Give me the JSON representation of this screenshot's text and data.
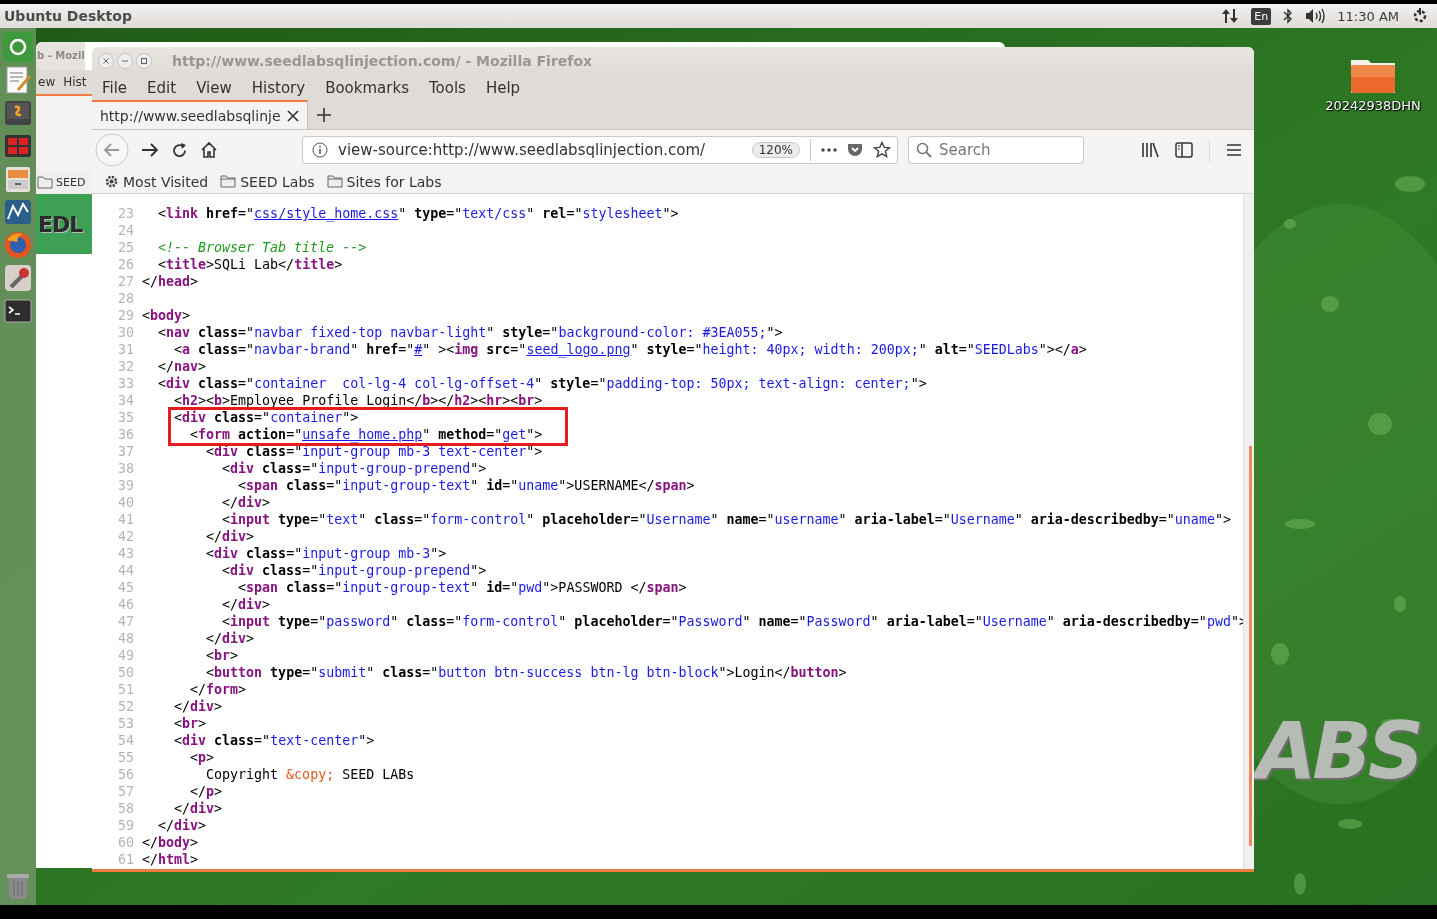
{
  "top_panel": {
    "title": "Ubuntu Desktop",
    "keyboard": "En",
    "time": "11:30 AM"
  },
  "desktop": {
    "folder_label": "20242938DHN",
    "logo_text": "ABS"
  },
  "background_window": {
    "title": "b - Mozil",
    "menu": [
      "ew",
      "Hist"
    ],
    "bookmark": "SEED",
    "banner_text": "EDL"
  },
  "browser": {
    "title": "http://www.seedlabsqlinjection.com/ - Mozilla Firefox",
    "menu": [
      "File",
      "Edit",
      "View",
      "History",
      "Bookmarks",
      "Tools",
      "Help"
    ],
    "tabs": [
      {
        "label": "http://www.seedlabsqlinje",
        "selected": true
      }
    ],
    "url": "view-source:http://www.seedlabsqlinjection.com/",
    "zoom": "120%",
    "search": {
      "placeholder": "Search"
    },
    "bookmarks": [
      {
        "kind": "smart",
        "label": "Most Visited"
      },
      {
        "kind": "folder",
        "label": "SEED Labs"
      },
      {
        "kind": "folder",
        "label": "Sites for Labs"
      }
    ],
    "source": {
      "lines": [
        {
          "n": "23",
          "tokens": [
            {
              "kind": "p",
              "text": "  <"
            },
            {
              "kind": "tag",
              "text": "link"
            },
            {
              "kind": "attr",
              "text": " href"
            },
            {
              "kind": "p",
              "text": "=\""
            },
            {
              "kind": "link",
              "text": "css/style_home.css"
            },
            {
              "kind": "p",
              "text": "\""
            },
            {
              "kind": "attr",
              "text": " type"
            },
            {
              "kind": "p",
              "text": "=\""
            },
            {
              "kind": "val",
              "text": "text/css"
            },
            {
              "kind": "p",
              "text": "\""
            },
            {
              "kind": "attr",
              "text": " rel"
            },
            {
              "kind": "p",
              "text": "=\""
            },
            {
              "kind": "val",
              "text": "stylesheet"
            },
            {
              "kind": "p",
              "text": "\">"
            }
          ]
        },
        {
          "n": "24"
        },
        {
          "n": "25",
          "tokens": [
            {
              "kind": "cmt",
              "text": "  <!-- Browser Tab title -->"
            }
          ]
        },
        {
          "n": "26",
          "tokens": [
            {
              "kind": "p",
              "text": "  <"
            },
            {
              "kind": "tag",
              "text": "title"
            },
            {
              "kind": "p",
              "text": ">SQLi Lab</"
            },
            {
              "kind": "tag",
              "text": "title"
            },
            {
              "kind": "p",
              "text": ">"
            }
          ]
        },
        {
          "n": "27",
          "tokens": [
            {
              "kind": "p",
              "text": "</"
            },
            {
              "kind": "tag",
              "text": "head"
            },
            {
              "kind": "p",
              "text": ">"
            }
          ]
        },
        {
          "n": "28"
        },
        {
          "n": "29",
          "tokens": [
            {
              "kind": "p",
              "text": "<"
            },
            {
              "kind": "tag",
              "text": "body"
            },
            {
              "kind": "p",
              "text": ">"
            }
          ]
        },
        {
          "n": "30",
          "tokens": [
            {
              "kind": "p",
              "text": "  <"
            },
            {
              "kind": "tag",
              "text": "nav"
            },
            {
              "kind": "attr",
              "text": " class"
            },
            {
              "kind": "p",
              "text": "=\""
            },
            {
              "kind": "val",
              "text": "navbar fixed-top navbar-light"
            },
            {
              "kind": "p",
              "text": "\""
            },
            {
              "kind": "attr",
              "text": " style"
            },
            {
              "kind": "p",
              "text": "=\""
            },
            {
              "kind": "val",
              "text": "background-color: #3EA055;"
            },
            {
              "kind": "p",
              "text": "\">"
            }
          ]
        },
        {
          "n": "31",
          "tokens": [
            {
              "kind": "p",
              "text": "    <"
            },
            {
              "kind": "tag",
              "text": "a"
            },
            {
              "kind": "attr",
              "text": " class"
            },
            {
              "kind": "p",
              "text": "=\""
            },
            {
              "kind": "val",
              "text": "navbar-brand"
            },
            {
              "kind": "p",
              "text": "\""
            },
            {
              "kind": "attr",
              "text": " href"
            },
            {
              "kind": "p",
              "text": "=\""
            },
            {
              "kind": "link",
              "text": "#"
            },
            {
              "kind": "p",
              "text": "\" ><"
            },
            {
              "kind": "tag",
              "text": "img"
            },
            {
              "kind": "attr",
              "text": " src"
            },
            {
              "kind": "p",
              "text": "=\""
            },
            {
              "kind": "link",
              "text": "seed_logo.png"
            },
            {
              "kind": "p",
              "text": "\""
            },
            {
              "kind": "attr",
              "text": " style"
            },
            {
              "kind": "p",
              "text": "=\""
            },
            {
              "kind": "val",
              "text": "height: 40px; width: 200px;"
            },
            {
              "kind": "p",
              "text": "\""
            },
            {
              "kind": "attr",
              "text": " alt"
            },
            {
              "kind": "p",
              "text": "=\""
            },
            {
              "kind": "val",
              "text": "SEEDLabs"
            },
            {
              "kind": "p",
              "text": "\"></"
            },
            {
              "kind": "tag",
              "text": "a"
            },
            {
              "kind": "p",
              "text": ">"
            }
          ]
        },
        {
          "n": "32",
          "tokens": [
            {
              "kind": "p",
              "text": "  </"
            },
            {
              "kind": "tag",
              "text": "nav"
            },
            {
              "kind": "p",
              "text": ">"
            }
          ]
        },
        {
          "n": "33",
          "tokens": [
            {
              "kind": "p",
              "text": "  <"
            },
            {
              "kind": "tag",
              "text": "div"
            },
            {
              "kind": "attr",
              "text": " class"
            },
            {
              "kind": "p",
              "text": "=\""
            },
            {
              "kind": "val",
              "text": "container  col-lg-4 col-lg-offset-4"
            },
            {
              "kind": "p",
              "text": "\""
            },
            {
              "kind": "attr",
              "text": " style"
            },
            {
              "kind": "p",
              "text": "=\""
            },
            {
              "kind": "val",
              "text": "padding-top: 50px; text-align: center;"
            },
            {
              "kind": "p",
              "text": "\">"
            }
          ]
        },
        {
          "n": "34",
          "tokens": [
            {
              "kind": "p",
              "text": "    <"
            },
            {
              "kind": "tag",
              "text": "h2"
            },
            {
              "kind": "p",
              "text": "><"
            },
            {
              "kind": "tag",
              "text": "b"
            },
            {
              "kind": "p",
              "text": ">Employee Profile Login</"
            },
            {
              "kind": "tag",
              "text": "b"
            },
            {
              "kind": "p",
              "text": "></"
            },
            {
              "kind": "tag",
              "text": "h2"
            },
            {
              "kind": "p",
              "text": "><"
            },
            {
              "kind": "tag",
              "text": "hr"
            },
            {
              "kind": "p",
              "text": "><"
            },
            {
              "kind": "tag",
              "text": "br"
            },
            {
              "kind": "p",
              "text": ">"
            }
          ]
        },
        {
          "n": "35",
          "tokens": [
            {
              "kind": "p",
              "text": "    <"
            },
            {
              "kind": "tag",
              "text": "div"
            },
            {
              "kind": "attr",
              "text": " class"
            },
            {
              "kind": "p",
              "text": "=\""
            },
            {
              "kind": "val",
              "text": "container"
            },
            {
              "kind": "p",
              "text": "\">"
            }
          ]
        },
        {
          "n": "36",
          "tokens": [
            {
              "kind": "p",
              "text": "      <"
            },
            {
              "kind": "tag",
              "text": "form"
            },
            {
              "kind": "attr",
              "text": " action"
            },
            {
              "kind": "p",
              "text": "=\""
            },
            {
              "kind": "link",
              "text": "unsafe_home.php"
            },
            {
              "kind": "p",
              "text": "\""
            },
            {
              "kind": "attr",
              "text": " method"
            },
            {
              "kind": "p",
              "text": "=\""
            },
            {
              "kind": "val",
              "text": "get"
            },
            {
              "kind": "p",
              "text": "\">"
            }
          ]
        },
        {
          "n": "37",
          "tokens": [
            {
              "kind": "p",
              "text": "        <"
            },
            {
              "kind": "tag",
              "text": "div"
            },
            {
              "kind": "attr",
              "text": " class"
            },
            {
              "kind": "p",
              "text": "=\""
            },
            {
              "kind": "val",
              "text": "input-group mb-3 text-center"
            },
            {
              "kind": "p",
              "text": "\">"
            }
          ]
        },
        {
          "n": "38",
          "tokens": [
            {
              "kind": "p",
              "text": "          <"
            },
            {
              "kind": "tag",
              "text": "div"
            },
            {
              "kind": "attr",
              "text": " class"
            },
            {
              "kind": "p",
              "text": "=\""
            },
            {
              "kind": "val",
              "text": "input-group-prepend"
            },
            {
              "kind": "p",
              "text": "\">"
            }
          ]
        },
        {
          "n": "39",
          "tokens": [
            {
              "kind": "p",
              "text": "            <"
            },
            {
              "kind": "tag",
              "text": "span"
            },
            {
              "kind": "attr",
              "text": " class"
            },
            {
              "kind": "p",
              "text": "=\""
            },
            {
              "kind": "val",
              "text": "input-group-text"
            },
            {
              "kind": "p",
              "text": "\""
            },
            {
              "kind": "attr",
              "text": " id"
            },
            {
              "kind": "p",
              "text": "=\""
            },
            {
              "kind": "val",
              "text": "uname"
            },
            {
              "kind": "p",
              "text": "\">USERNAME</"
            },
            {
              "kind": "tag",
              "text": "span"
            },
            {
              "kind": "p",
              "text": ">"
            }
          ]
        },
        {
          "n": "40",
          "tokens": [
            {
              "kind": "p",
              "text": "          </"
            },
            {
              "kind": "tag",
              "text": "div"
            },
            {
              "kind": "p",
              "text": ">"
            }
          ]
        },
        {
          "n": "41",
          "tokens": [
            {
              "kind": "p",
              "text": "          <"
            },
            {
              "kind": "tag",
              "text": "input"
            },
            {
              "kind": "attr",
              "text": " type"
            },
            {
              "kind": "p",
              "text": "=\""
            },
            {
              "kind": "val",
              "text": "text"
            },
            {
              "kind": "p",
              "text": "\""
            },
            {
              "kind": "attr",
              "text": " class"
            },
            {
              "kind": "p",
              "text": "=\""
            },
            {
              "kind": "val",
              "text": "form-control"
            },
            {
              "kind": "p",
              "text": "\""
            },
            {
              "kind": "attr",
              "text": " placeholder"
            },
            {
              "kind": "p",
              "text": "=\""
            },
            {
              "kind": "val",
              "text": "Username"
            },
            {
              "kind": "p",
              "text": "\""
            },
            {
              "kind": "attr",
              "text": " name"
            },
            {
              "kind": "p",
              "text": "=\""
            },
            {
              "kind": "val",
              "text": "username"
            },
            {
              "kind": "p",
              "text": "\""
            },
            {
              "kind": "attr",
              "text": " aria-label"
            },
            {
              "kind": "p",
              "text": "=\""
            },
            {
              "kind": "val",
              "text": "Username"
            },
            {
              "kind": "p",
              "text": "\""
            },
            {
              "kind": "attr",
              "text": " aria-describedby"
            },
            {
              "kind": "p",
              "text": "=\""
            },
            {
              "kind": "val",
              "text": "uname"
            },
            {
              "kind": "p",
              "text": "\">"
            }
          ]
        },
        {
          "n": "42",
          "tokens": [
            {
              "kind": "p",
              "text": "        </"
            },
            {
              "kind": "tag",
              "text": "div"
            },
            {
              "kind": "p",
              "text": ">"
            }
          ]
        },
        {
          "n": "43",
          "tokens": [
            {
              "kind": "p",
              "text": "        <"
            },
            {
              "kind": "tag",
              "text": "div"
            },
            {
              "kind": "attr",
              "text": " class"
            },
            {
              "kind": "p",
              "text": "=\""
            },
            {
              "kind": "val",
              "text": "input-group mb-3"
            },
            {
              "kind": "p",
              "text": "\">"
            }
          ]
        },
        {
          "n": "44",
          "tokens": [
            {
              "kind": "p",
              "text": "          <"
            },
            {
              "kind": "tag",
              "text": "div"
            },
            {
              "kind": "attr",
              "text": " class"
            },
            {
              "kind": "p",
              "text": "=\""
            },
            {
              "kind": "val",
              "text": "input-group-prepend"
            },
            {
              "kind": "p",
              "text": "\">"
            }
          ]
        },
        {
          "n": "45",
          "tokens": [
            {
              "kind": "p",
              "text": "            <"
            },
            {
              "kind": "tag",
              "text": "span"
            },
            {
              "kind": "attr",
              "text": " class"
            },
            {
              "kind": "p",
              "text": "=\""
            },
            {
              "kind": "val",
              "text": "input-group-text"
            },
            {
              "kind": "p",
              "text": "\""
            },
            {
              "kind": "attr",
              "text": " id"
            },
            {
              "kind": "p",
              "text": "=\""
            },
            {
              "kind": "val",
              "text": "pwd"
            },
            {
              "kind": "p",
              "text": "\">PASSWORD </"
            },
            {
              "kind": "tag",
              "text": "span"
            },
            {
              "kind": "p",
              "text": ">"
            }
          ]
        },
        {
          "n": "46",
          "tokens": [
            {
              "kind": "p",
              "text": "          </"
            },
            {
              "kind": "tag",
              "text": "div"
            },
            {
              "kind": "p",
              "text": ">"
            }
          ]
        },
        {
          "n": "47",
          "tokens": [
            {
              "kind": "p",
              "text": "          <"
            },
            {
              "kind": "tag",
              "text": "input"
            },
            {
              "kind": "attr",
              "text": " type"
            },
            {
              "kind": "p",
              "text": "=\""
            },
            {
              "kind": "val",
              "text": "password"
            },
            {
              "kind": "p",
              "text": "\""
            },
            {
              "kind": "attr",
              "text": " class"
            },
            {
              "kind": "p",
              "text": "=\""
            },
            {
              "kind": "val",
              "text": "form-control"
            },
            {
              "kind": "p",
              "text": "\""
            },
            {
              "kind": "attr",
              "text": " placeholder"
            },
            {
              "kind": "p",
              "text": "=\""
            },
            {
              "kind": "val",
              "text": "Password"
            },
            {
              "kind": "p",
              "text": "\""
            },
            {
              "kind": "attr",
              "text": " name"
            },
            {
              "kind": "p",
              "text": "=\""
            },
            {
              "kind": "val",
              "text": "Password"
            },
            {
              "kind": "p",
              "text": "\""
            },
            {
              "kind": "attr",
              "text": " aria-label"
            },
            {
              "kind": "p",
              "text": "=\""
            },
            {
              "kind": "val",
              "text": "Username"
            },
            {
              "kind": "p",
              "text": "\""
            },
            {
              "kind": "attr",
              "text": " aria-describedby"
            },
            {
              "kind": "p",
              "text": "=\""
            },
            {
              "kind": "val",
              "text": "pwd"
            },
            {
              "kind": "p",
              "text": "\">"
            }
          ]
        },
        {
          "n": "48",
          "tokens": [
            {
              "kind": "p",
              "text": "        </"
            },
            {
              "kind": "tag",
              "text": "div"
            },
            {
              "kind": "p",
              "text": ">"
            }
          ]
        },
        {
          "n": "49",
          "tokens": [
            {
              "kind": "p",
              "text": "        <"
            },
            {
              "kind": "tag",
              "text": "br"
            },
            {
              "kind": "p",
              "text": ">"
            }
          ]
        },
        {
          "n": "50",
          "tokens": [
            {
              "kind": "p",
              "text": "        <"
            },
            {
              "kind": "tag",
              "text": "button"
            },
            {
              "kind": "attr",
              "text": " type"
            },
            {
              "kind": "p",
              "text": "=\""
            },
            {
              "kind": "val",
              "text": "submit"
            },
            {
              "kind": "p",
              "text": "\""
            },
            {
              "kind": "attr",
              "text": " class"
            },
            {
              "kind": "p",
              "text": "=\""
            },
            {
              "kind": "val",
              "text": "button btn-success btn-lg btn-block"
            },
            {
              "kind": "p",
              "text": "\">Login</"
            },
            {
              "kind": "tag",
              "text": "button"
            },
            {
              "kind": "p",
              "text": ">"
            }
          ]
        },
        {
          "n": "51",
          "tokens": [
            {
              "kind": "p",
              "text": "      </"
            },
            {
              "kind": "tag",
              "text": "form"
            },
            {
              "kind": "p",
              "text": ">"
            }
          ]
        },
        {
          "n": "52",
          "tokens": [
            {
              "kind": "p",
              "text": "    </"
            },
            {
              "kind": "tag",
              "text": "div"
            },
            {
              "kind": "p",
              "text": ">"
            }
          ]
        },
        {
          "n": "53",
          "tokens": [
            {
              "kind": "p",
              "text": "    <"
            },
            {
              "kind": "tag",
              "text": "br"
            },
            {
              "kind": "p",
              "text": ">"
            }
          ]
        },
        {
          "n": "54",
          "tokens": [
            {
              "kind": "p",
              "text": "    <"
            },
            {
              "kind": "tag",
              "text": "div"
            },
            {
              "kind": "attr",
              "text": " class"
            },
            {
              "kind": "p",
              "text": "=\""
            },
            {
              "kind": "val",
              "text": "text-center"
            },
            {
              "kind": "p",
              "text": "\">"
            }
          ]
        },
        {
          "n": "55",
          "tokens": [
            {
              "kind": "p",
              "text": "      <"
            },
            {
              "kind": "tag",
              "text": "p"
            },
            {
              "kind": "p",
              "text": ">"
            }
          ]
        },
        {
          "n": "56",
          "tokens": [
            {
              "kind": "p",
              "text": "        Copyright "
            },
            {
              "kind": "ent",
              "text": "&copy;"
            },
            {
              "kind": "p",
              "text": " SEED LABs"
            }
          ]
        },
        {
          "n": "57",
          "tokens": [
            {
              "kind": "p",
              "text": "      </"
            },
            {
              "kind": "tag",
              "text": "p"
            },
            {
              "kind": "p",
              "text": ">"
            }
          ]
        },
        {
          "n": "58",
          "tokens": [
            {
              "kind": "p",
              "text": "    </"
            },
            {
              "kind": "tag",
              "text": "div"
            },
            {
              "kind": "p",
              "text": ">"
            }
          ]
        },
        {
          "n": "59",
          "tokens": [
            {
              "kind": "p",
              "text": "  </"
            },
            {
              "kind": "tag",
              "text": "div"
            },
            {
              "kind": "p",
              "text": ">"
            }
          ]
        },
        {
          "n": "60",
          "tokens": [
            {
              "kind": "p",
              "text": "</"
            },
            {
              "kind": "tag",
              "text": "body"
            },
            {
              "kind": "p",
              "text": ">"
            }
          ]
        },
        {
          "n": "61",
          "tokens": [
            {
              "kind": "p",
              "text": "</"
            },
            {
              "kind": "tag",
              "text": "html"
            },
            {
              "kind": "p",
              "text": ">"
            }
          ]
        }
      ]
    }
  }
}
